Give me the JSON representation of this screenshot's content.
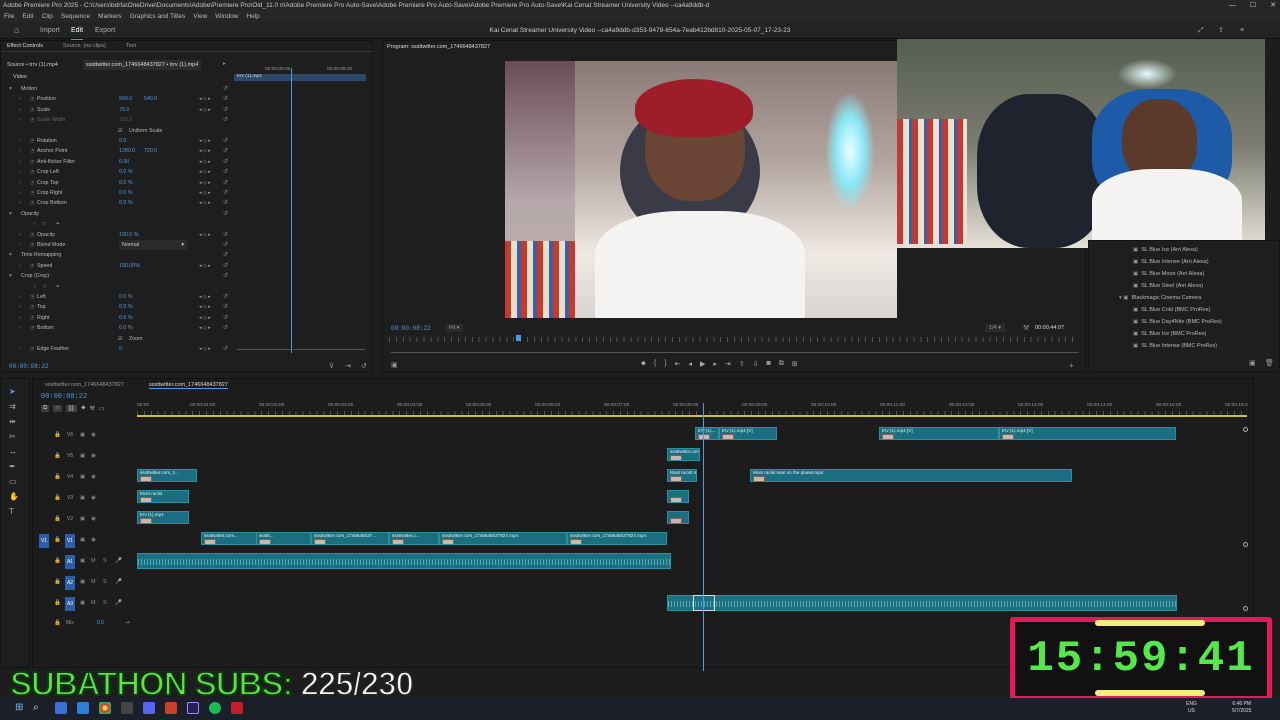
{
  "titlebar": {
    "title": "Adobe Premiere Pro 2025 - C:\\Users\\bdrfa\\OneDrive\\Documents\\Adobe\\Premiere Pro\\Old_11.0 n\\Adobe Premiere Pro Auto-Save\\Adobe Premiere Pro Auto-Save\\Adobe Premiere Pro Auto-Save\\Kai Cenat Streamer University Video --ca4a9ddb-d"
  },
  "menubar": {
    "items": [
      "File",
      "Edit",
      "Clip",
      "Sequence",
      "Markers",
      "Graphics and Titles",
      "View",
      "Window",
      "Help"
    ]
  },
  "workspace": {
    "tabs": [
      "Import",
      "Edit",
      "Export"
    ],
    "active": "Edit",
    "document": "Kai Cenat Streamer University Video --ca4a9ddb-d353-9479-654a-7eab412bd810-2025-05-07_17-23-23"
  },
  "effect_controls": {
    "tabs": [
      "Effect Controls",
      "Source: (no clips)",
      "Text"
    ],
    "source_label": "Source • trrv (1).mp4",
    "clip_label": "sssttwitter.com_1746648437827 • trrv (1).mp4",
    "mini_clip": "trrv (1).mp4",
    "ruler_left": "00:00:08:00",
    "ruler_right": "00:00:08:30",
    "section_video": "Video",
    "rows": [
      {
        "label": "Motion",
        "value": "",
        "type": "group"
      },
      {
        "label": "Position",
        "value": "960.0",
        "value2": "540.0"
      },
      {
        "label": "Scale",
        "value": "75.0"
      },
      {
        "label": "Scale Width",
        "value": "100.0",
        "dim": true
      },
      {
        "label": "Uniform Scale",
        "value": "",
        "type": "check"
      },
      {
        "label": "Rotation",
        "value": "0.0"
      },
      {
        "label": "Anchor Point",
        "value": "1280.0",
        "value2": "720.0"
      },
      {
        "label": "Anti-flicker Filter",
        "value": "0.00"
      },
      {
        "label": "Crop Left",
        "value": "0.0 %"
      },
      {
        "label": "Crop Top",
        "value": "0.0 %"
      },
      {
        "label": "Crop Right",
        "value": "0.0 %"
      },
      {
        "label": "Crop Bottom",
        "value": "0.0 %"
      },
      {
        "label": "Opacity",
        "value": "",
        "type": "group"
      },
      {
        "label": "",
        "value": "",
        "type": "masks"
      },
      {
        "label": "Opacity",
        "value": "100.0 %"
      },
      {
        "label": "Blend Mode",
        "value": "Normal",
        "type": "select"
      },
      {
        "label": "Time Remapping",
        "value": "",
        "type": "group"
      },
      {
        "label": "Speed",
        "value": "100.00%"
      },
      {
        "label": "Crop (Crop)",
        "value": "",
        "type": "group"
      },
      {
        "label": "",
        "value": "",
        "type": "masks"
      },
      {
        "label": "Left",
        "value": "0.0 %"
      },
      {
        "label": "Top",
        "value": "0.0 %"
      },
      {
        "label": "Right",
        "value": "0.0 %"
      },
      {
        "label": "Bottom",
        "value": "0.0 %"
      },
      {
        "label": "Zoom",
        "value": "",
        "type": "check"
      },
      {
        "label": "Edge Feather",
        "value": "0"
      }
    ],
    "timecode": "00:00:08:22"
  },
  "program": {
    "tab": "Program: sssttwitter.com_1746648437827",
    "timecode": "00:00:08:22",
    "fit": "Fit",
    "quality": "1/4",
    "duration": "00:00:44:07"
  },
  "effects_list": {
    "items": [
      "SL Blue Ice (Arri Alexa)",
      "SL Blue Intense (Arri Alexa)",
      "SL Blue Moon (Arri Alexa)",
      "SL Blue Steel (Arri Alexa)",
      "Blackmagic Cinema Camera",
      "SL Blue Cold (BMC ProRes)",
      "SL Blue Day4Nite (BMC ProRes)",
      "SL Blue Ice (BMC ProRes)",
      "SL Blue Intense (BMC ProRes)"
    ]
  },
  "timeline": {
    "tabs": [
      "sssttwitter.com_1746648437827",
      "sssttwitter.com_1746648437827"
    ],
    "timecode": "00:00:08:22",
    "ruler": [
      "00:00",
      "00:00:01:00",
      "00:00:02:00",
      "00:00:03:00",
      "00:00:04:00",
      "00:00:05:00",
      "00:00:06:00",
      "00:00:07:00",
      "00:00:08:00",
      "00:00:09:00",
      "00:00:10:00",
      "00:00:11:00",
      "00:00:12:00",
      "00:00:13:00",
      "00:00:14:00",
      "00:00:15:00",
      "00:00:16:0"
    ],
    "video_tracks": [
      "V6",
      "V5",
      "V4",
      "V3",
      "V2",
      "V1"
    ],
    "audio_tracks": [
      "A1",
      "A2",
      "A3"
    ],
    "mix_label": "Mix",
    "mix_value": "0.0",
    "clips": {
      "v6": [
        "trrv (1)...",
        "trrv (1).mp4 [V]",
        "trrv (1).mp4 [V]",
        "trrv (1).mp4 [V]"
      ],
      "v5": [
        "sssttwitter.com..."
      ],
      "v4a": "sssttwitter.com_1...",
      "v4b": "Most racist man...",
      "v4c": "Most racist man on the planet.mp4",
      "v3": "Most racist",
      "v2": "trrv (1).mp4",
      "v1": [
        "sssttwitter.com...",
        "sssttt...",
        "sssttwitter.com_1746648437...",
        "sssttwitter.c...",
        "sssttwitter.com_1746648437827.mp4",
        "sssttwitter.com_1746648437827.mp4"
      ]
    }
  },
  "overlay": {
    "subathon_label": "SUBATHON SUBS:",
    "subathon_count": "225/230",
    "timer": "15:59:41"
  },
  "taskbar": {
    "lang1": "ENG",
    "lang2": "US",
    "time": "6:46 PM",
    "date": "5/7/2025"
  },
  "colors": {
    "accent": "#4f9ae6",
    "clip": "#1a6e80",
    "timer_green": "#56e84a",
    "timer_border": "#e5195a",
    "sub_green": "#63e04c"
  }
}
